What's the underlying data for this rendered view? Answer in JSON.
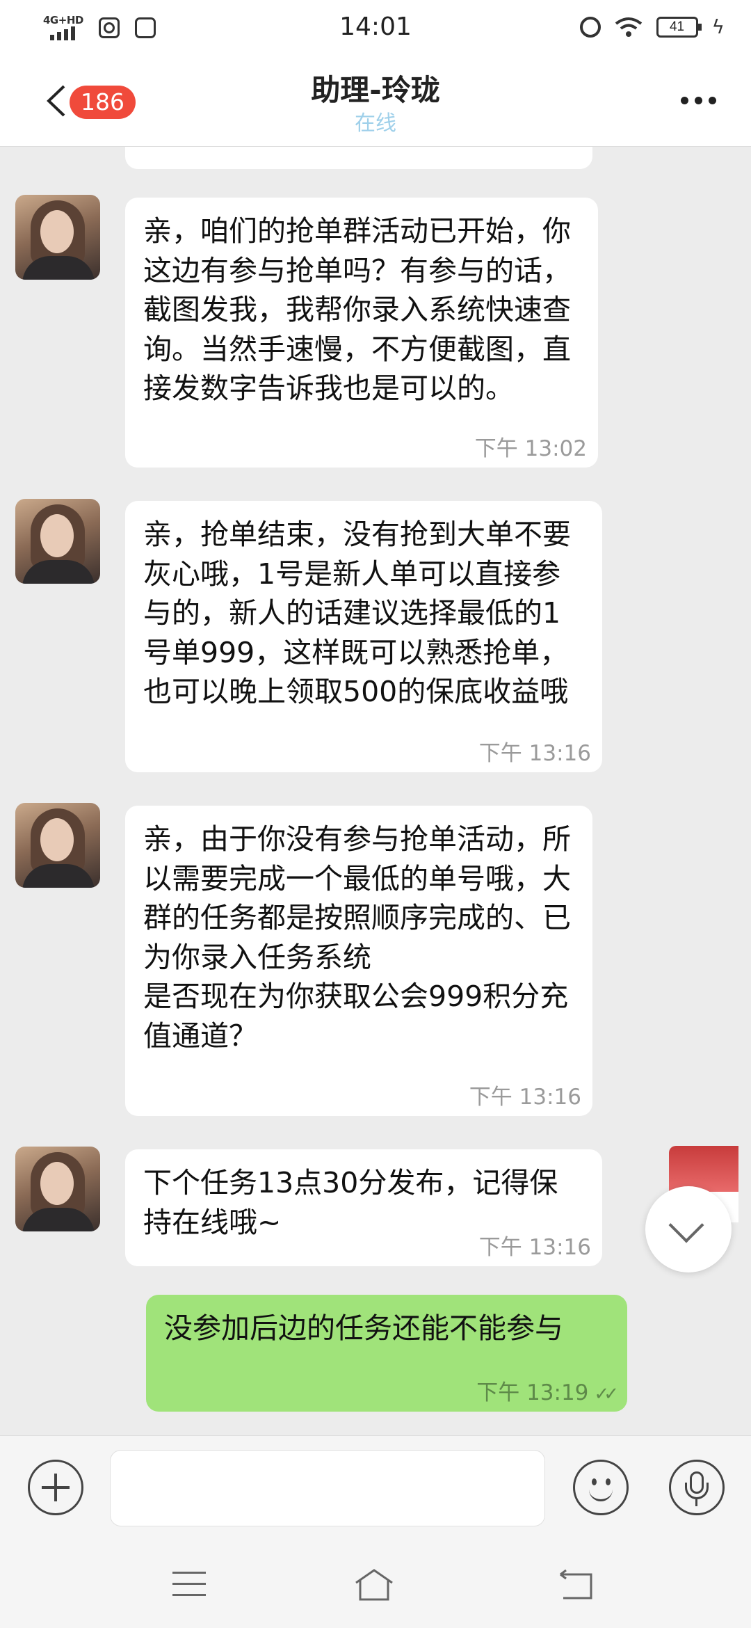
{
  "status_bar": {
    "network": "4G+HD",
    "time": "14:01",
    "battery": "41"
  },
  "header": {
    "unread_count": "186",
    "title": "助理-玲珑",
    "subtitle": "在线"
  },
  "messages": [
    {
      "direction": "in",
      "text": "亲，咱们的抢单群活动已开始，你这边有参与抢单吗？有参与的话，截图发我，我帮你录入系统快速查询。当然手速慢，不方便截图，直接发数字告诉我也是可以的。",
      "time": "下午 13:02"
    },
    {
      "direction": "in",
      "text": "亲，抢单结束，没有抢到大单不要灰心哦，1号是新人单可以直接参与的，新人的话建议选择最低的1号单999，这样既可以熟悉抢单，也可以晚上领取500的保底收益哦",
      "time": "下午 13:16"
    },
    {
      "direction": "in",
      "text": "亲，由于你没有参与抢单活动，所以需要完成一个最低的单号哦，大群的任务都是按照顺序完成的、已为你录入任务系统\n是否现在为你获取公会999积分充值通道？",
      "time": "下午 13:16"
    },
    {
      "direction": "in",
      "text": "下个任务13点30分发布，记得保持在线哦~",
      "time": "下午 13:16"
    },
    {
      "direction": "out",
      "text": "没参加后边的任务还能不能参与",
      "time": "下午 13:19"
    }
  ],
  "icons": {
    "back": "chevron-left-icon",
    "more": "more-dots-icon",
    "plus": "plus-icon",
    "emoji": "smiley-icon",
    "voice": "microphone-icon",
    "scroll": "chevron-down-icon"
  },
  "colors": {
    "badge": "#f04a3b",
    "outgoing_bubble": "#a0e37a",
    "online_status": "#9fd0ea"
  }
}
